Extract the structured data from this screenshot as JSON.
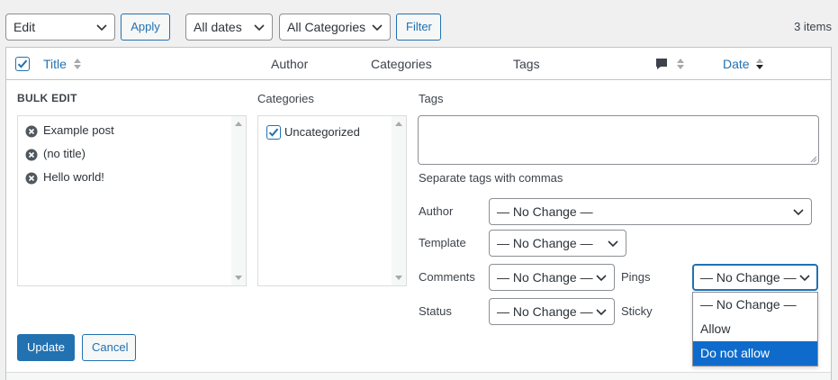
{
  "toolbar": {
    "bulk_action": "Edit",
    "apply_label": "Apply",
    "dates_filter": "All dates",
    "categories_filter": "All Categories",
    "filter_label": "Filter",
    "items_count": "3 items"
  },
  "table_header": {
    "title": "Title",
    "author": "Author",
    "categories": "Categories",
    "tags": "Tags",
    "date": "Date"
  },
  "bulk_edit": {
    "heading": "BULK EDIT",
    "posts": [
      "Example post",
      "(no title)",
      "Hello world!"
    ],
    "categories_label": "Categories",
    "category_items": [
      {
        "label": "Uncategorized",
        "checked": true
      }
    ],
    "tags_label": "Tags",
    "tags_value": "",
    "tags_help": "Separate tags with commas",
    "author_label": "Author",
    "author_value": "— No Change —",
    "template_label": "Template",
    "template_value": "— No Change —",
    "comments_label": "Comments",
    "comments_value": "— No Change —",
    "pings_label": "Pings",
    "pings_value": "— No Change —",
    "status_label": "Status",
    "status_value": "— No Change —",
    "sticky_label": "Sticky",
    "pings_options": [
      "— No Change —",
      "Allow",
      "Do not allow"
    ],
    "pings_highlighted": "Do not allow",
    "update_label": "Update",
    "cancel_label": "Cancel"
  },
  "colors": {
    "accent": "#2271b1",
    "highlight": "#0f6bcb"
  }
}
